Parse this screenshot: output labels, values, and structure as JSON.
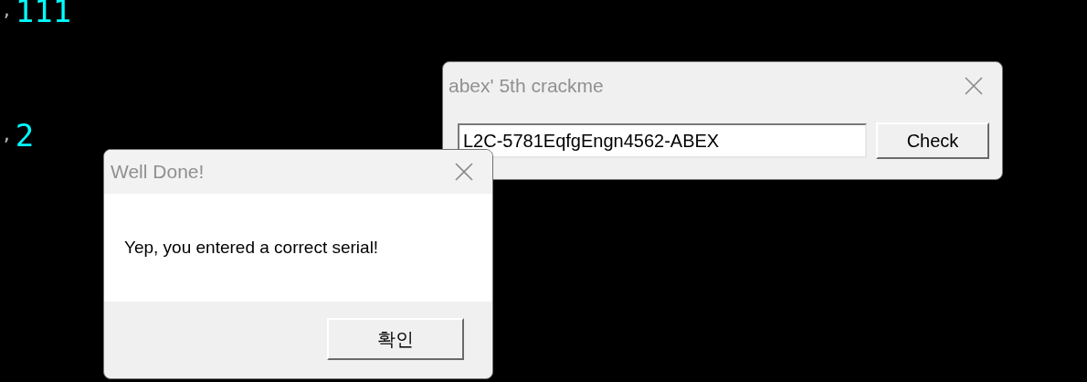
{
  "console_lines": [
    {
      "separator": ",",
      "value": "111"
    },
    {
      "separator": ",",
      "value": "2"
    }
  ],
  "crackme_window": {
    "title": "abex' 5th crackme",
    "serial_field": {
      "value": "L2C-5781EqfgEngn4562-ABEX"
    },
    "check_button": "Check"
  },
  "message_box": {
    "title": "Well Done!",
    "message": "Yep, you entered a correct serial!",
    "ok_button": "확인"
  }
}
